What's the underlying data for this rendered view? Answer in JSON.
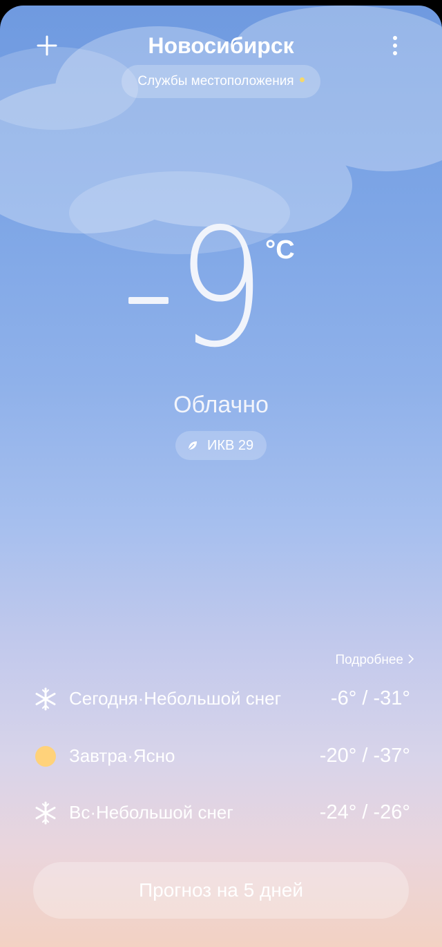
{
  "header": {
    "city": "Новосибирск",
    "location_services": "Службы местоположения"
  },
  "current": {
    "temperature": "9",
    "unit": "°C",
    "condition": "Облачно",
    "aqi": "ИКВ 29"
  },
  "forecast": {
    "more_label": "Подробнее",
    "days": [
      {
        "label": "Сегодня·Небольшой снег",
        "temps": "-6° / -31°",
        "icon": "snowflake-icon"
      },
      {
        "label": "Завтра·Ясно",
        "temps": "-20° / -37°",
        "icon": "sun-icon"
      },
      {
        "label": "Вс·Небольшой снег",
        "temps": "-24° / -26°",
        "icon": "snowflake-icon"
      }
    ]
  },
  "five_day_button": "Прогноз на 5 дней",
  "colors": {
    "sky_top": "#6f9ae0",
    "sky_bottom": "#f3d2c3",
    "location_dot": "#f5d86b",
    "sun": "#ffd27a"
  }
}
